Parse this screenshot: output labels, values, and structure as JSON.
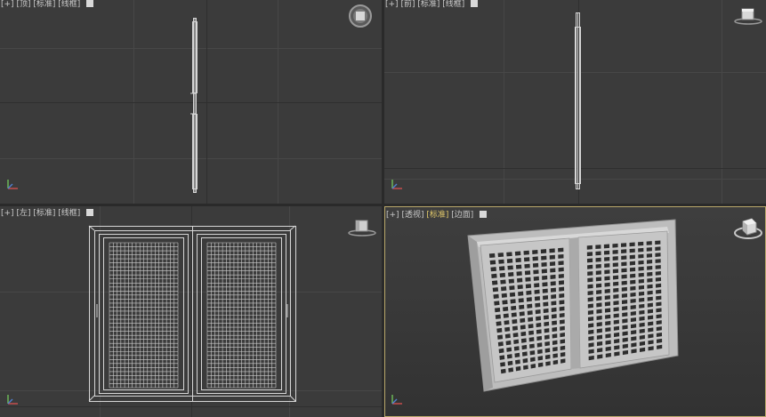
{
  "viewports": {
    "top": {
      "plus": "[+]",
      "name": "[顶]",
      "shading_mode": "[标准]",
      "display": "[线框]"
    },
    "front": {
      "plus": "[+]",
      "name": "[前]",
      "shading_mode": "[标准]",
      "display": "[线框]"
    },
    "left": {
      "plus": "[+]",
      "name": "[左]",
      "shading_mode": "[标准]",
      "display": "[线框]"
    },
    "perspective": {
      "plus": "[+]",
      "name": "[透视]",
      "shading_mode": "[标准]",
      "display": "[边面]",
      "active": true
    }
  },
  "icons": {
    "viewcube": "viewcube-icon",
    "steering_wheel": "steering-wheel-icon",
    "axis_gizmo": "axis-tripod-icon",
    "view_options": "viewport-options-checkbox-icon"
  },
  "colors": {
    "viewport_bg": "#3b3b3b",
    "grid_line": "#474747",
    "grid_axis": "#2e2e2e",
    "active_border": "#b9a86a",
    "label_text": "#c8c8c8",
    "label_highlight": "#e2c96a",
    "wireframe": "#d6d6d6",
    "shaded_model": "#bdbdbd"
  }
}
